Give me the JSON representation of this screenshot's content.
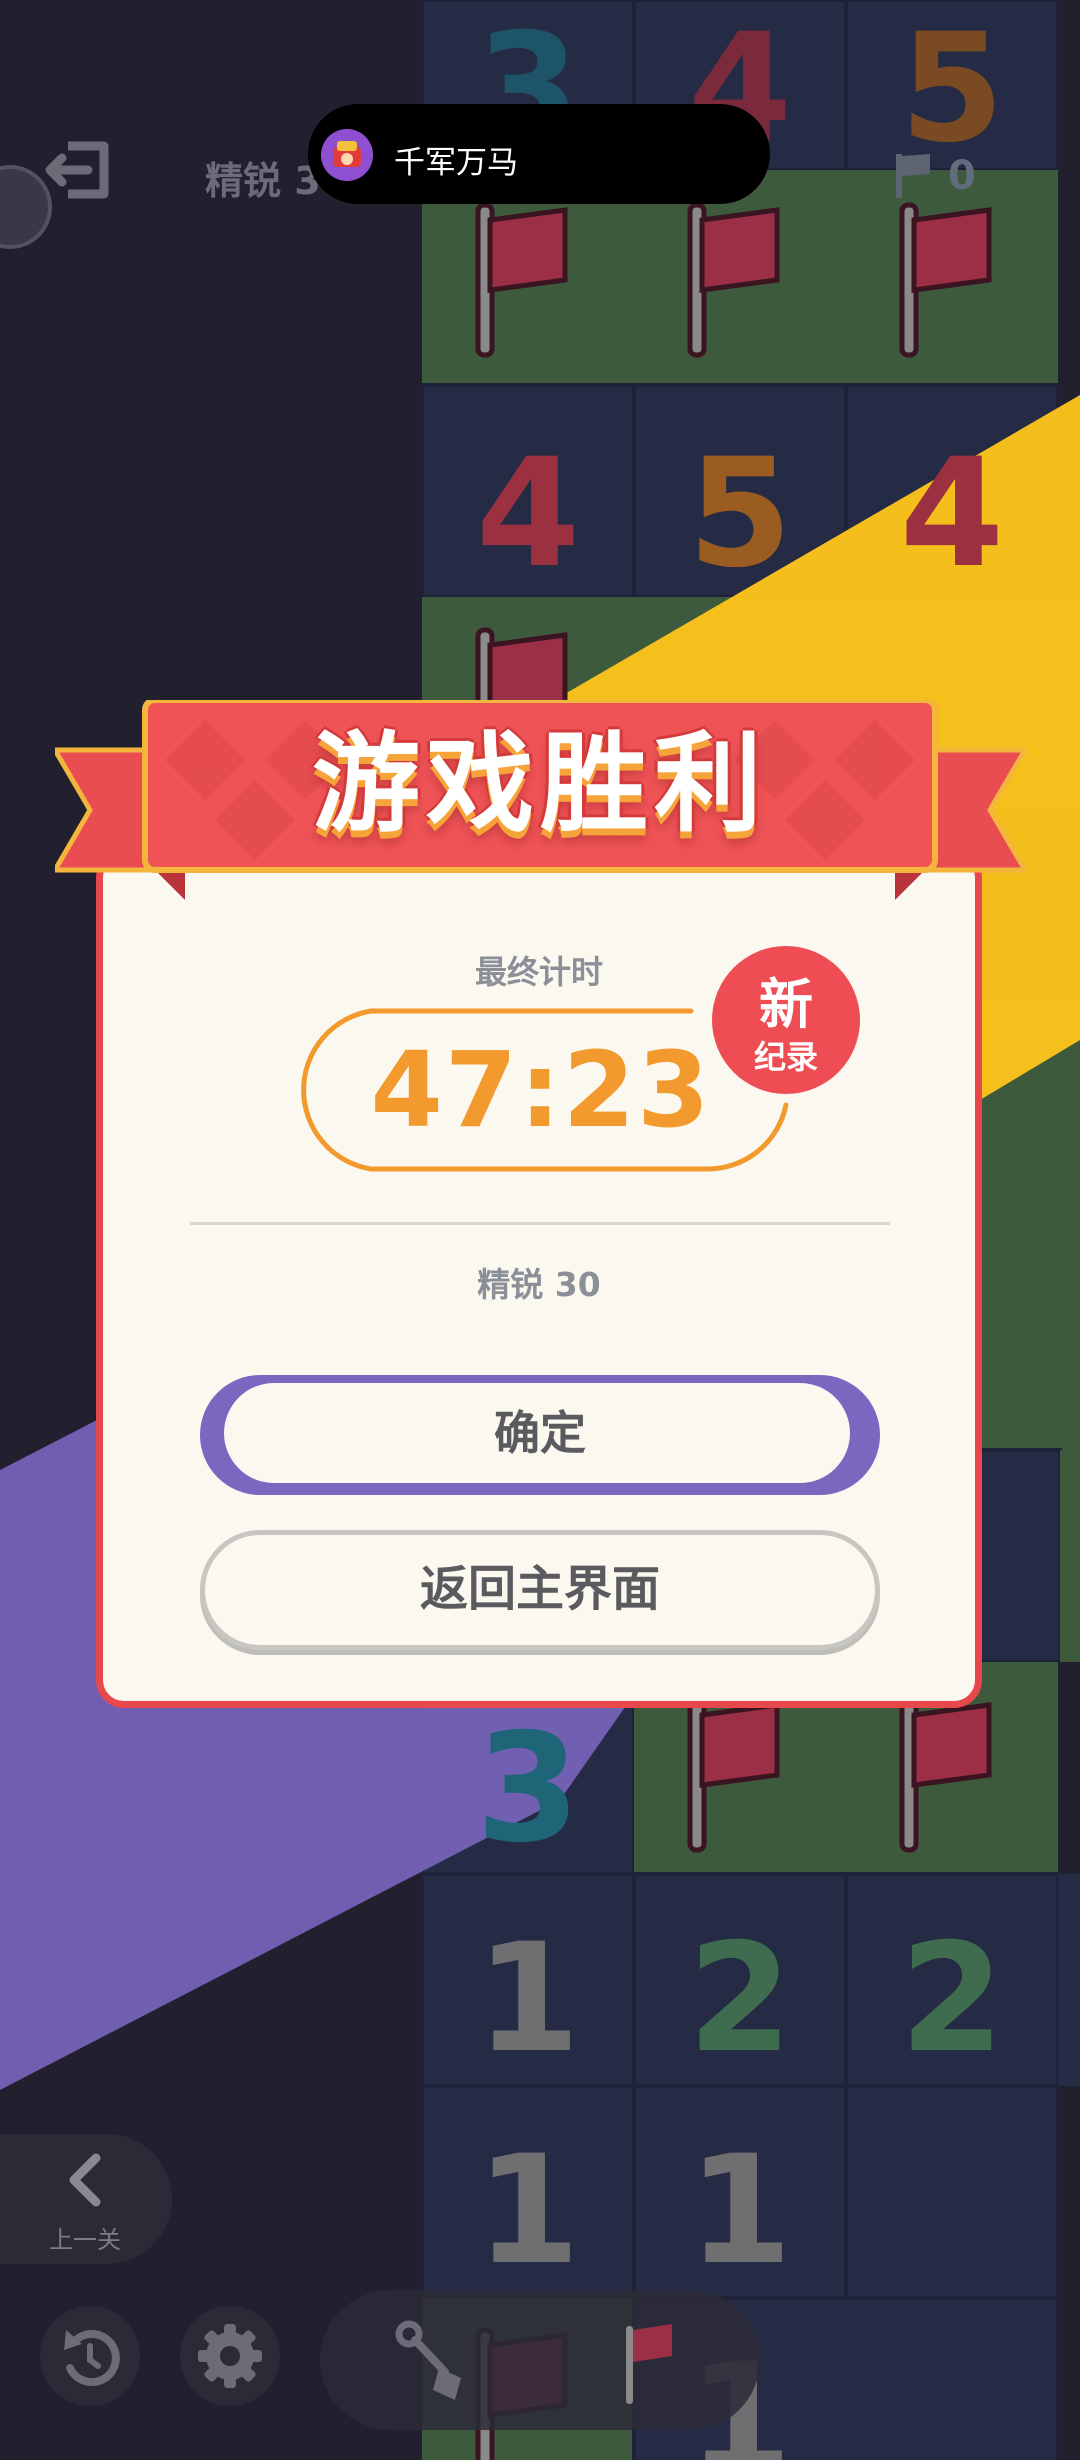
{
  "top_bar": {
    "level_label": "精锐 3",
    "flag_count": "0"
  },
  "notification": {
    "text": "千军万马"
  },
  "board": {
    "numbers": [
      "3",
      "4",
      "5",
      "4",
      "5",
      "4",
      "3",
      "1",
      "2",
      "2",
      "1",
      "1",
      "1"
    ]
  },
  "dialog": {
    "title": "游戏胜利",
    "time_label": "最终计时",
    "time_value": "47:23",
    "record_badge_line1": "新",
    "record_badge_line2": "纪录",
    "level_label": "精锐 30",
    "confirm_label": "确定",
    "home_label": "返回主界面"
  },
  "bottom_bar": {
    "prev_label": "上一关"
  },
  "colors": {
    "dialog_border": "#e8484c",
    "time_orange": "#f39a2f",
    "confirm_purple": "#7a67c0",
    "record_red": "#ee4d53",
    "banner_red": "#ef5356",
    "yellow_ray": "#ffc61a"
  },
  "icons": {
    "exit": "exit-icon",
    "flag": "flag-icon",
    "restart": "restart-icon",
    "settings": "gear-icon",
    "shovel": "shovel-icon",
    "prev": "chevron-left-icon"
  }
}
